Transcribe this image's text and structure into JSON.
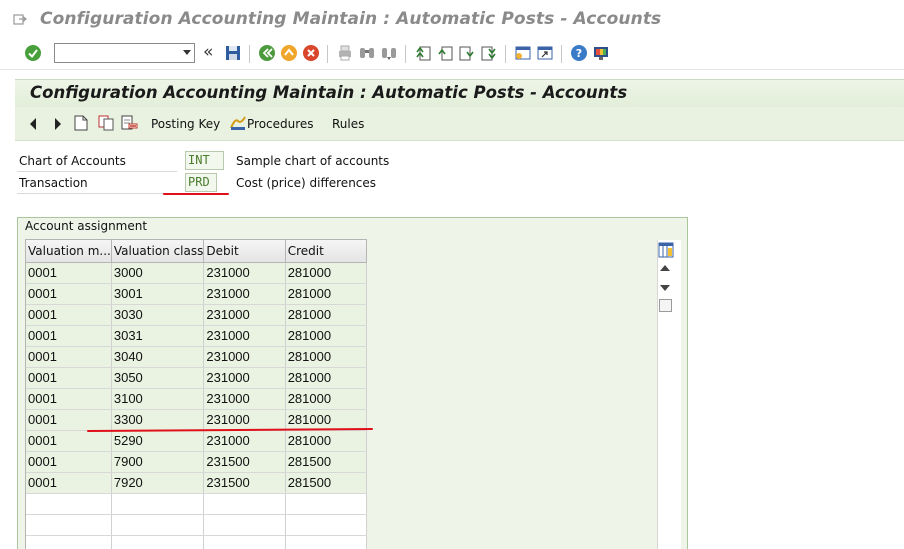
{
  "window": {
    "title": "Configuration Accounting Maintain : Automatic Posts - Accounts"
  },
  "toolbar": {
    "icons": [
      "enter-icon",
      "command-field",
      "back-nav-icon",
      "save-icon",
      "back-icon",
      "exit-icon",
      "cancel-icon",
      "print-icon",
      "find-icon",
      "find-next-icon",
      "first-page-icon",
      "previous-page-icon",
      "next-page-icon",
      "last-page-icon",
      "create-session-icon",
      "shortcut-icon",
      "help-icon",
      "layout-icon"
    ],
    "command_value": ""
  },
  "screen": {
    "title": "Configuration Accounting Maintain : Automatic Posts - Accounts",
    "app_toolbar": {
      "posting_key_label": "Posting Key",
      "procedures_label": "Procedures",
      "rules_label": "Rules"
    },
    "fields": {
      "chart_of_accounts": {
        "label": "Chart of Accounts",
        "value": "INT",
        "description": "Sample chart of accounts"
      },
      "transaction": {
        "label": "Transaction",
        "value": "PRD",
        "description": "Cost (price) differences"
      }
    },
    "account_assignment": {
      "title": "Account assignment",
      "columns": [
        "Valuation m...",
        "Valuation class",
        "Debit",
        "Credit"
      ],
      "rows": [
        [
          "0001",
          "3000",
          "231000",
          "281000"
        ],
        [
          "0001",
          "3001",
          "231000",
          "281000"
        ],
        [
          "0001",
          "3030",
          "231000",
          "281000"
        ],
        [
          "0001",
          "3031",
          "231000",
          "281000"
        ],
        [
          "0001",
          "3040",
          "231000",
          "281000"
        ],
        [
          "0001",
          "3050",
          "231000",
          "281000"
        ],
        [
          "0001",
          "3100",
          "231000",
          "281000"
        ],
        [
          "0001",
          "3300",
          "231000",
          "281000"
        ],
        [
          "0001",
          "5290",
          "231000",
          "281000"
        ],
        [
          "0001",
          "7900",
          "231500",
          "281500"
        ],
        [
          "0001",
          "7920",
          "231500",
          "281500"
        ]
      ],
      "empty_rows": 3
    }
  },
  "colors": {
    "header_bg": "#e2eed9",
    "row_bg": "#eaf3e2",
    "value_text": "#4a7d2b",
    "annotation_red": "#e0101b",
    "title_gray": "#8a8a8a"
  }
}
